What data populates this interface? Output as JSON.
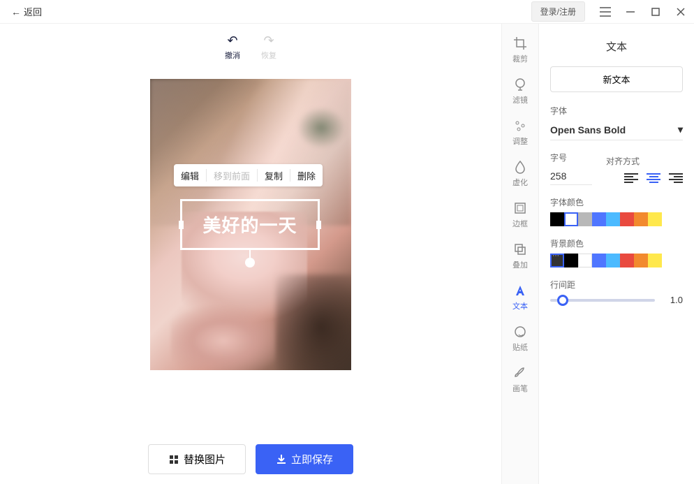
{
  "topbar": {
    "back": "返回",
    "login": "登录/注册"
  },
  "undo_redo": {
    "undo": "撤消",
    "redo": "恢复"
  },
  "text_toolbar": {
    "edit": "编辑",
    "bring_front": "移到前面",
    "copy": "复制",
    "delete": "删除"
  },
  "canvas_text": "美好的一天",
  "bottom": {
    "replace": "替换图片",
    "save": "立即保存"
  },
  "rail": {
    "crop": "裁剪",
    "filter": "滤镜",
    "adjust": "调整",
    "blur": "虚化",
    "border": "边框",
    "overlay": "叠加",
    "text": "文本",
    "sticker": "贴纸",
    "brush": "画笔"
  },
  "panel": {
    "title": "文本",
    "new_text": "新文本",
    "font_label": "字体",
    "font_value": "Open Sans Bold",
    "size_label": "字号",
    "align_label": "对齐方式",
    "size_value": "258",
    "font_color_label": "字体颜色",
    "bg_color_label": "背景颜色",
    "line_height_label": "行间距",
    "line_height_value": "1.0",
    "font_colors": [
      "#000000",
      "#ffffff",
      "#b8b8b8",
      "#4f76ff",
      "#4cbaff",
      "#e94a3f",
      "#f28a2e",
      "#ffe84c"
    ],
    "bg_colors": [
      "#333333",
      "#000000",
      "#ffffff",
      "#4f76ff",
      "#4cbaff",
      "#e94a3f",
      "#f28a2e",
      "#ffe84c"
    ]
  }
}
